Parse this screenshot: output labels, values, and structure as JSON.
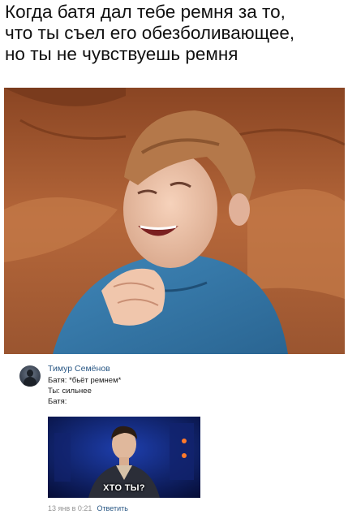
{
  "meme": {
    "caption_lines": [
      "Когда батя дал тебе ремня за то,",
      "что ты съел его обезболивающее,",
      "но ты не чувствуешь ремня"
    ]
  },
  "comment": {
    "author": "Тимур Семёнов",
    "lines": [
      "Батя: *бьёт ремнем*",
      "Ты: сильнее",
      "Батя:"
    ],
    "attachment_caption": "ХТО ТЫ?",
    "timestamp": "13 янв в 0:21",
    "reply_label": "Ответить"
  },
  "colors": {
    "link": "#2a5885",
    "meta": "#939393",
    "attachment_bg": "#0b1a5e",
    "couch": "#b5673a"
  }
}
